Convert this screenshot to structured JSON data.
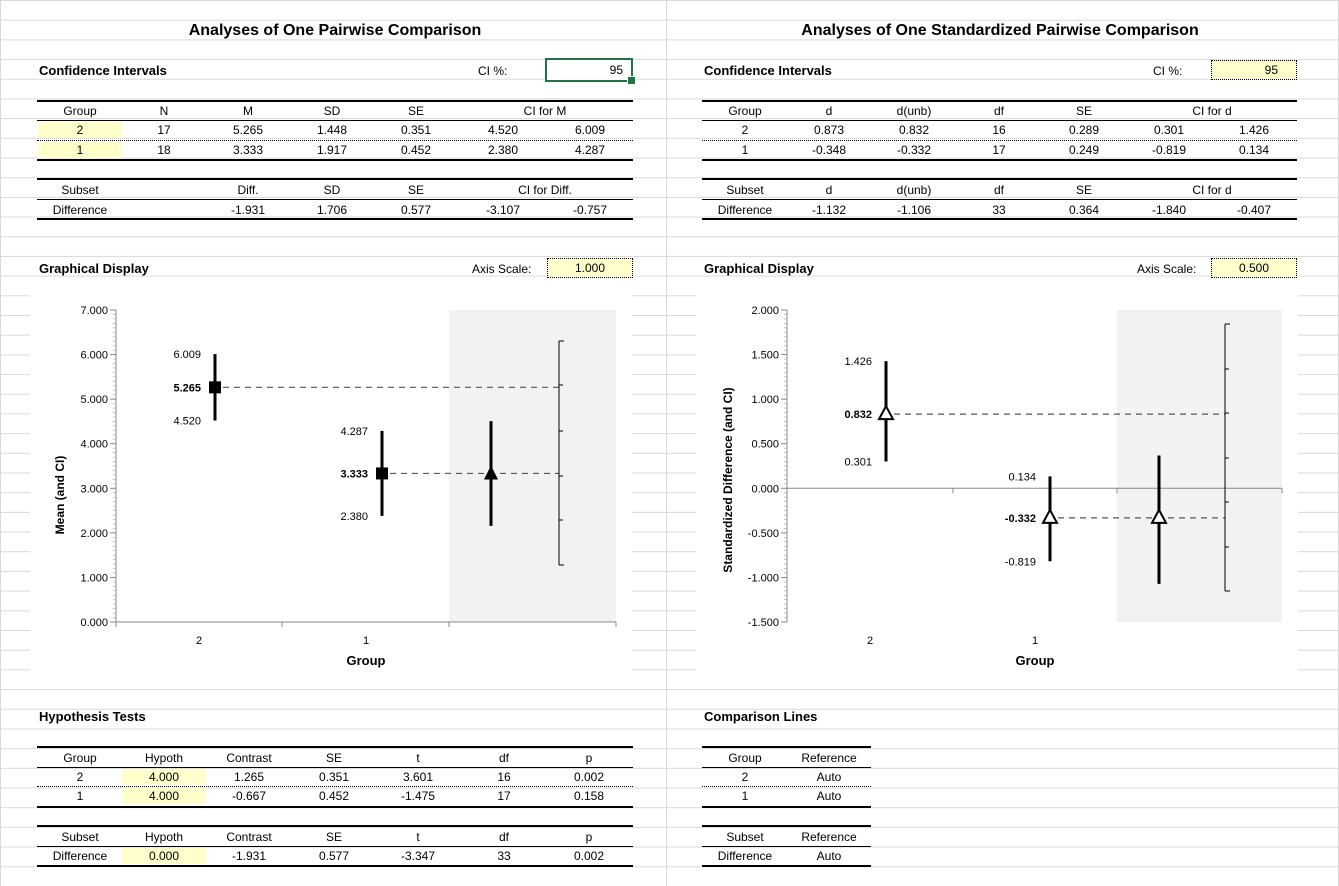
{
  "left": {
    "title": "Analyses of One Pairwise Comparison",
    "ci_section": "Confidence Intervals",
    "ci_label": "CI %:",
    "ci_value": "95",
    "group_headers": [
      "Group",
      "N",
      "M",
      "SD",
      "SE",
      "CI for M"
    ],
    "group_rows": [
      [
        "2",
        "17",
        "5.265",
        "1.448",
        "0.351",
        "4.520",
        "6.009"
      ],
      [
        "1",
        "18",
        "3.333",
        "1.917",
        "0.452",
        "2.380",
        "4.287"
      ]
    ],
    "subset_headers": [
      "Subset",
      "Diff.",
      "SD",
      "SE",
      "CI for Diff."
    ],
    "subset_row": [
      "Difference",
      "-1.931",
      "1.706",
      "0.577",
      "-3.107",
      "-0.757"
    ],
    "graph_section": "Graphical Display",
    "axis_scale_label": "Axis Scale:",
    "axis_scale_value": "1.000",
    "ylabel": "Mean (and CI)",
    "xlabel": "Group",
    "hyp_section": "Hypothesis Tests",
    "hyp_headers": [
      "Group",
      "Hypoth",
      "Contrast",
      "SE",
      "t",
      "df",
      "p"
    ],
    "hyp_rows": [
      [
        "2",
        "4.000",
        "1.265",
        "0.351",
        "3.601",
        "16",
        "0.002"
      ],
      [
        "1",
        "4.000",
        "-0.667",
        "0.452",
        "-1.475",
        "17",
        "0.158"
      ]
    ],
    "hyp_subset_headers": [
      "Subset",
      "Hypoth",
      "Contrast",
      "SE",
      "t",
      "df",
      "p"
    ],
    "hyp_subset_row": [
      "Difference",
      "0.000",
      "-1.931",
      "0.577",
      "-3.347",
      "33",
      "0.002"
    ]
  },
  "right": {
    "title": "Analyses of One Standardized Pairwise Comparison",
    "ci_section": "Confidence Intervals",
    "ci_label": "CI %:",
    "ci_value": "95",
    "group_headers": [
      "Group",
      "d",
      "d(unb)",
      "df",
      "SE",
      "CI for d"
    ],
    "group_rows": [
      [
        "2",
        "0.873",
        "0.832",
        "16",
        "0.289",
        "0.301",
        "1.426"
      ],
      [
        "1",
        "-0.348",
        "-0.332",
        "17",
        "0.249",
        "-0.819",
        "0.134"
      ]
    ],
    "subset_headers": [
      "Subset",
      "d",
      "d(unb)",
      "df",
      "SE",
      "CI for d"
    ],
    "subset_row": [
      "Difference",
      "-1.132",
      "-1.106",
      "33",
      "0.364",
      "-1.840",
      "-0.407"
    ],
    "graph_section": "Graphical Display",
    "axis_scale_label": "Axis Scale:",
    "axis_scale_value": "0.500",
    "ylabel": "Standardized Difference (and CI)",
    "xlabel": "Group",
    "cmp_section": "Comparison Lines",
    "cmp_headers": [
      "Group",
      "Reference"
    ],
    "cmp_rows": [
      [
        "2",
        "Auto"
      ],
      [
        "1",
        "Auto"
      ]
    ],
    "cmp_subset_headers": [
      "Subset",
      "Reference"
    ],
    "cmp_subset_row": [
      "Difference",
      "Auto"
    ]
  },
  "chart_data": [
    {
      "type": "scatter",
      "title": "",
      "xlabel": "Group",
      "ylabel": "Mean (and CI)",
      "ylim": [
        0,
        7
      ],
      "y_ticks": [
        "0.000",
        "1.000",
        "2.000",
        "3.000",
        "4.000",
        "5.000",
        "6.000",
        "7.000"
      ],
      "categories": [
        "2",
        "1"
      ],
      "points": [
        {
          "group": "2",
          "y": 5.265,
          "lo": 4.52,
          "hi": 6.009,
          "label": "5.265",
          "lo_label": "4.520",
          "hi_label": "6.009"
        },
        {
          "group": "1",
          "y": 3.333,
          "lo": 2.38,
          "hi": 4.287,
          "label": "3.333",
          "lo_label": "2.380",
          "hi_label": "4.287"
        }
      ],
      "difference": {
        "y": 3.333,
        "lo": 2.157,
        "hi": 4.507
      },
      "grid": false
    },
    {
      "type": "scatter",
      "title": "",
      "xlabel": "Group",
      "ylabel": "Standardized Difference (and CI)",
      "ylim": [
        -1.5,
        2
      ],
      "y_ticks": [
        "-1.500",
        "-1.000",
        "-0.500",
        "0.000",
        "0.500",
        "1.000",
        "1.500",
        "2.000"
      ],
      "categories": [
        "2",
        "1"
      ],
      "points": [
        {
          "group": "2",
          "y": 0.832,
          "lo": 0.301,
          "hi": 1.426,
          "label": "0.832",
          "lo_label": "0.301",
          "hi_label": "1.426"
        },
        {
          "group": "1",
          "y": -0.332,
          "lo": -0.819,
          "hi": 0.134,
          "label": "-0.332",
          "lo_label": "-0.819",
          "hi_label": "0.134"
        }
      ],
      "difference": {
        "y": -0.332,
        "lo": -1.072,
        "hi": 0.368
      },
      "grid": false
    }
  ]
}
